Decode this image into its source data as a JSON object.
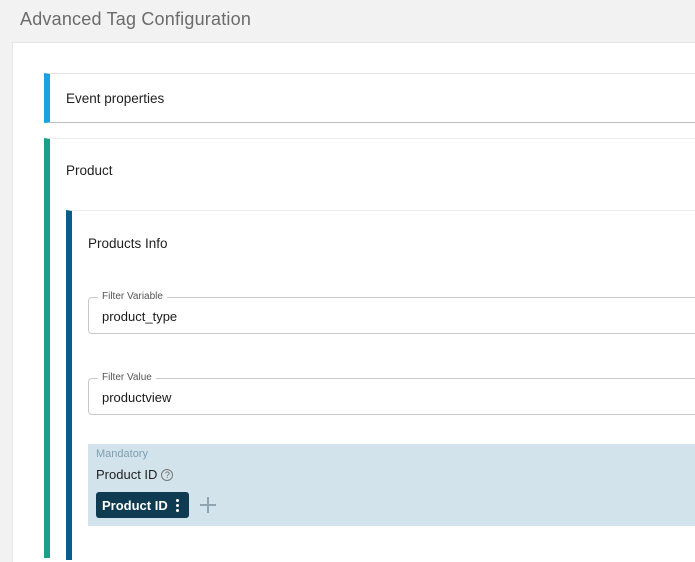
{
  "page": {
    "title": "Advanced Tag Configuration"
  },
  "sections": {
    "event_properties": {
      "title": "Event properties"
    },
    "product": {
      "title": "Product"
    },
    "products_info": {
      "title": "Products Info"
    }
  },
  "fields": {
    "filter_variable": {
      "label": "Filter Variable",
      "value": "product_type"
    },
    "filter_value": {
      "label": "Filter Value",
      "value": "productview"
    }
  },
  "mandatory": {
    "label": "Mandatory",
    "field_name": "Product ID",
    "help_icon": "help-circle-icon",
    "chip_label": "Product ID",
    "chip_menu_icon": "kebab-menu-icon",
    "add_icon": "plus-icon"
  },
  "colors": {
    "event_accent": "#1ba1e0",
    "product_accent": "#19a08a",
    "products_info_accent": "#0e5b8a",
    "mandatory_bg": "#d2e3ec",
    "chip_bg": "#0e3a52"
  }
}
